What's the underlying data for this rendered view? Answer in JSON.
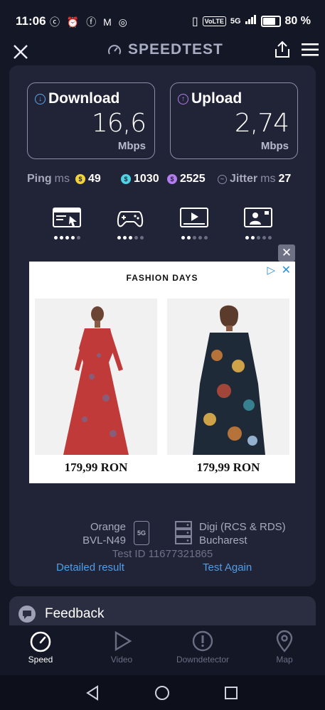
{
  "status": {
    "time": "11:06",
    "notif_icons": "ⓒ ⏰ ⓕ M ◎",
    "volte": "VoLTE",
    "net": "5G",
    "battery": "80 %"
  },
  "appbar": {
    "title": "SPEEDTEST"
  },
  "download": {
    "label": "Download",
    "value": "16,6",
    "unit": "Mbps"
  },
  "upload": {
    "label": "Upload",
    "value": "2,74",
    "unit": "Mbps"
  },
  "metrics": {
    "ping_label": "Ping",
    "ms1": "ms",
    "ping_value": "49",
    "jitter_a": "1030",
    "jitter_b": "2525",
    "jitter_label": "Jitter",
    "ms2": "ms",
    "jitter_value": "27"
  },
  "categories": [
    {
      "icon": "browsing-icon",
      "level": 4
    },
    {
      "icon": "gaming-icon",
      "level": 3
    },
    {
      "icon": "video-icon",
      "level": 2
    },
    {
      "icon": "video-call-icon",
      "level": 2
    }
  ],
  "ad": {
    "brand": "FASHION  DAYS",
    "products": [
      {
        "price": "179,99 RON"
      },
      {
        "price": "179,99 RON"
      }
    ]
  },
  "server": {
    "carrier": "Orange",
    "device": "BVL-N49",
    "network_badge": "5G",
    "isp": "Digi (RCS & RDS)",
    "city": "Bucharest",
    "test_id": "Test ID 11677321865"
  },
  "links": {
    "detailed": "Detailed result",
    "again": "Test Again"
  },
  "feedback": {
    "label": "Feedback"
  },
  "nav": [
    {
      "label": "Speed"
    },
    {
      "label": "Video"
    },
    {
      "label": "Downdetector"
    },
    {
      "label": "Map"
    }
  ],
  "colors": {
    "accent_link": "#4f9ee8",
    "download": "#5aa8f0",
    "upload": "#b47cf0",
    "ping": "#f2d43a",
    "jitter_a": "#4fd4e6"
  }
}
